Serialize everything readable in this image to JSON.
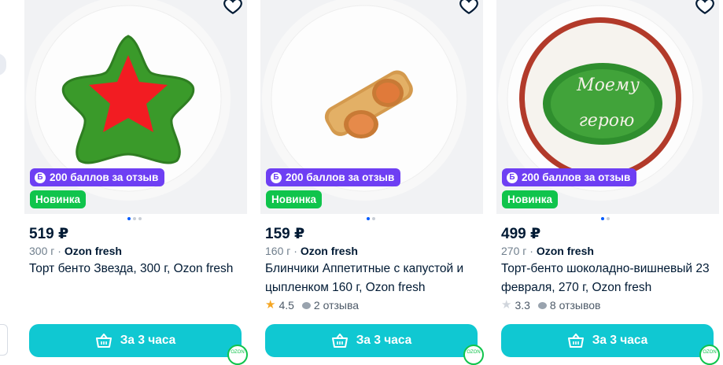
{
  "colors": {
    "accent_teal": "#10c8d2",
    "bonus_purple": "#6e3ff3",
    "new_green": "#10c44c",
    "price": "#001a34"
  },
  "cards": [
    {
      "bonus": "200 баллов за отзыв",
      "new_badge": "Новинка",
      "price": "519 ₽",
      "weight": "300 г",
      "brand": "Ozon fresh",
      "title": "Торт бенто Звезда, 300 г, Ozon fresh",
      "rating": "",
      "reviews": "",
      "delivery": "За 3 часа",
      "image_icon": "star-cake"
    },
    {
      "bonus": "200 баллов за отзыв",
      "new_badge": "Новинка",
      "price": "159 ₽",
      "weight": "160 г",
      "brand": "Ozon fresh",
      "title": "Блинчики Аппетитные с капустой и цыпленком 160 г, Ozon fresh",
      "rating": "4.5",
      "reviews": "2 отзыва",
      "rating_color": "#f5a623",
      "delivery": "За 3 часа",
      "image_icon": "pancakes"
    },
    {
      "bonus": "200 баллов за отзыв",
      "new_badge": "Новинка",
      "price": "499 ₽",
      "weight": "270 г",
      "brand": "Ozon fresh",
      "title": "Торт-бенто шоколадно-вишневый 23 февраля, 270 г, Ozon fresh",
      "rating": "3.3",
      "reviews": "8 отзывов",
      "rating_color": "#d0d5dc",
      "delivery": "За 3 часа",
      "image_icon": "bento-cake",
      "cake_text": "Моему герою"
    }
  ]
}
